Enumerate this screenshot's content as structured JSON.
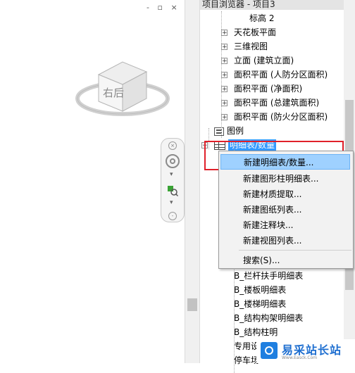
{
  "window_controls": [
    "-",
    "▫",
    "×"
  ],
  "viewcube": {
    "face_label": "右后"
  },
  "browser": {
    "title": "项目浏览器 - 项目3",
    "tree": [
      {
        "label": "标高 2",
        "level": 3,
        "expander": ""
      },
      {
        "label": "天花板平面",
        "level": 1,
        "expander": "+"
      },
      {
        "label": "三维视图",
        "level": 1,
        "expander": "+"
      },
      {
        "label": "立面 (建筑立面)",
        "level": 1,
        "expander": "+"
      },
      {
        "label": "面积平面 (人防分区面积)",
        "level": 1,
        "expander": "+"
      },
      {
        "label": "面积平面 (净面积)",
        "level": 1,
        "expander": "+"
      },
      {
        "label": "面积平面 (总建筑面积)",
        "level": 1,
        "expander": "+"
      },
      {
        "label": "面积平面 (防火分区面积)",
        "level": 1,
        "expander": "+"
      },
      {
        "label": "图例",
        "level": 0,
        "expander": "",
        "icon": "legend-icon"
      },
      {
        "label": "明细表/数量",
        "level": 0,
        "expander": "−",
        "icon": "schedule-icon",
        "selected": true
      },
      {
        "label": "B_栏杆扶手明细表",
        "level": 2,
        "expander": ""
      },
      {
        "label": "B_楼板明细表",
        "level": 2,
        "expander": ""
      },
      {
        "label": "B_楼梯明细表",
        "level": 2,
        "expander": ""
      },
      {
        "label": "B_结构构架明细表",
        "level": 2,
        "expander": ""
      },
      {
        "label": "B_结构柱明",
        "level": 2,
        "expander": ""
      },
      {
        "label": "专用设",
        "level": 2,
        "expander": ""
      },
      {
        "label": "停车场",
        "level": 2,
        "expander": ""
      }
    ]
  },
  "context_menu": {
    "items": [
      {
        "label": "新建明细表/数量...",
        "highlighted": true
      },
      {
        "label": "新建图形柱明细表...",
        "highlighted": false
      },
      {
        "label": "新建材质提取...",
        "highlighted": false
      },
      {
        "label": "新建图纸列表...",
        "highlighted": false
      },
      {
        "label": "新建注释块...",
        "highlighted": false
      },
      {
        "label": "新建视图列表...",
        "highlighted": false
      },
      {
        "label": "搜索(S)...",
        "highlighted": false
      }
    ]
  },
  "watermark": {
    "text": "易采站长站",
    "sub": "Www.Easck.Com"
  },
  "colors": {
    "selection": "#3399ff",
    "highlight": "#9fd1ff",
    "callout": "#e0202a"
  }
}
